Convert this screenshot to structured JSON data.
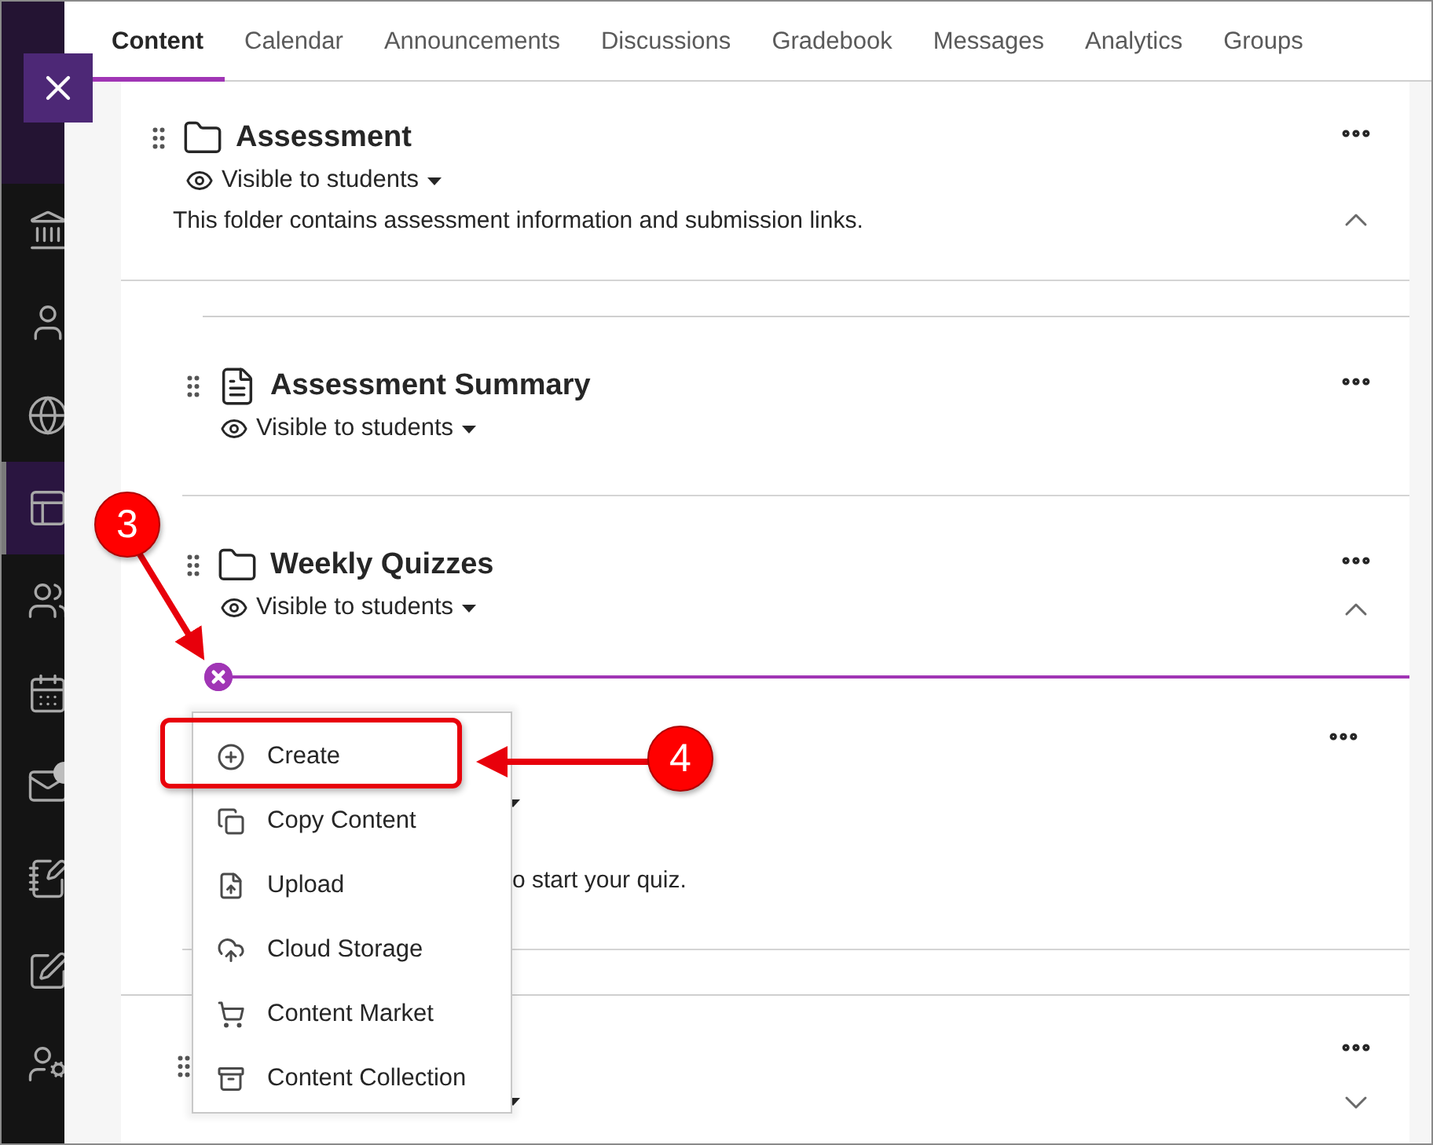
{
  "nav": {
    "items": [
      {
        "selected": false
      },
      {
        "selected": false
      },
      {
        "selected": false
      },
      {
        "selected": true
      },
      {
        "selected": false
      },
      {
        "selected": false
      },
      {
        "selected": false
      },
      {
        "selected": false
      },
      {
        "selected": false
      },
      {
        "selected": false
      }
    ]
  },
  "tabs": [
    {
      "label": "Content",
      "selected": true
    },
    {
      "label": "Calendar",
      "selected": false
    },
    {
      "label": "Announcements",
      "selected": false
    },
    {
      "label": "Discussions",
      "selected": false
    },
    {
      "label": "Gradebook",
      "selected": false
    },
    {
      "label": "Messages",
      "selected": false
    },
    {
      "label": "Analytics",
      "selected": false
    },
    {
      "label": "Groups",
      "selected": false
    }
  ],
  "items": [
    {
      "kind": "folder",
      "title": "Assessment",
      "visibility": "Visible to students",
      "description": "This folder contains assessment information and submission links.",
      "expanded": true,
      "children": [
        {
          "kind": "document",
          "title": "Assessment Summary",
          "visibility": "Visible to students"
        },
        {
          "kind": "folder",
          "title": "Weekly Quizzes",
          "visibility": "Visible to students",
          "expanded": true,
          "children": [
            {
              "description": "o start your quiz."
            }
          ]
        }
      ]
    },
    {
      "expanded": false
    }
  ],
  "add_menu": {
    "items": [
      {
        "label": "Create"
      },
      {
        "label": "Copy Content"
      },
      {
        "label": "Upload"
      },
      {
        "label": "Cloud Storage"
      },
      {
        "label": "Content Market"
      },
      {
        "label": "Content Collection"
      }
    ]
  },
  "callouts": [
    {
      "label": "3"
    },
    {
      "label": "4"
    }
  ]
}
